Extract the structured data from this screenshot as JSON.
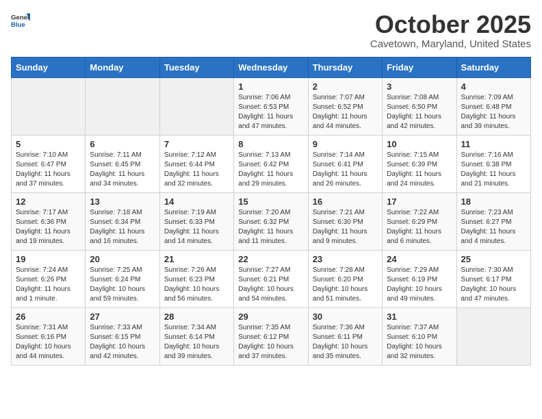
{
  "header": {
    "logo_general": "General",
    "logo_blue": "Blue",
    "month": "October 2025",
    "location": "Cavetown, Maryland, United States"
  },
  "weekdays": [
    "Sunday",
    "Monday",
    "Tuesday",
    "Wednesday",
    "Thursday",
    "Friday",
    "Saturday"
  ],
  "weeks": [
    [
      {
        "day": "",
        "info": ""
      },
      {
        "day": "",
        "info": ""
      },
      {
        "day": "",
        "info": ""
      },
      {
        "day": "1",
        "info": "Sunrise: 7:06 AM\nSunset: 6:53 PM\nDaylight: 11 hours and 47 minutes."
      },
      {
        "day": "2",
        "info": "Sunrise: 7:07 AM\nSunset: 6:52 PM\nDaylight: 11 hours and 44 minutes."
      },
      {
        "day": "3",
        "info": "Sunrise: 7:08 AM\nSunset: 6:50 PM\nDaylight: 11 hours and 42 minutes."
      },
      {
        "day": "4",
        "info": "Sunrise: 7:09 AM\nSunset: 6:48 PM\nDaylight: 11 hours and 39 minutes."
      }
    ],
    [
      {
        "day": "5",
        "info": "Sunrise: 7:10 AM\nSunset: 6:47 PM\nDaylight: 11 hours and 37 minutes."
      },
      {
        "day": "6",
        "info": "Sunrise: 7:11 AM\nSunset: 6:45 PM\nDaylight: 11 hours and 34 minutes."
      },
      {
        "day": "7",
        "info": "Sunrise: 7:12 AM\nSunset: 6:44 PM\nDaylight: 11 hours and 32 minutes."
      },
      {
        "day": "8",
        "info": "Sunrise: 7:13 AM\nSunset: 6:42 PM\nDaylight: 11 hours and 29 minutes."
      },
      {
        "day": "9",
        "info": "Sunrise: 7:14 AM\nSunset: 6:41 PM\nDaylight: 11 hours and 26 minutes."
      },
      {
        "day": "10",
        "info": "Sunrise: 7:15 AM\nSunset: 6:39 PM\nDaylight: 11 hours and 24 minutes."
      },
      {
        "day": "11",
        "info": "Sunrise: 7:16 AM\nSunset: 6:38 PM\nDaylight: 11 hours and 21 minutes."
      }
    ],
    [
      {
        "day": "12",
        "info": "Sunrise: 7:17 AM\nSunset: 6:36 PM\nDaylight: 11 hours and 19 minutes."
      },
      {
        "day": "13",
        "info": "Sunrise: 7:18 AM\nSunset: 6:34 PM\nDaylight: 11 hours and 16 minutes."
      },
      {
        "day": "14",
        "info": "Sunrise: 7:19 AM\nSunset: 6:33 PM\nDaylight: 11 hours and 14 minutes."
      },
      {
        "day": "15",
        "info": "Sunrise: 7:20 AM\nSunset: 6:32 PM\nDaylight: 11 hours and 11 minutes."
      },
      {
        "day": "16",
        "info": "Sunrise: 7:21 AM\nSunset: 6:30 PM\nDaylight: 11 hours and 9 minutes."
      },
      {
        "day": "17",
        "info": "Sunrise: 7:22 AM\nSunset: 6:29 PM\nDaylight: 11 hours and 6 minutes."
      },
      {
        "day": "18",
        "info": "Sunrise: 7:23 AM\nSunset: 6:27 PM\nDaylight: 11 hours and 4 minutes."
      }
    ],
    [
      {
        "day": "19",
        "info": "Sunrise: 7:24 AM\nSunset: 6:26 PM\nDaylight: 11 hours and 1 minute."
      },
      {
        "day": "20",
        "info": "Sunrise: 7:25 AM\nSunset: 6:24 PM\nDaylight: 10 hours and 59 minutes."
      },
      {
        "day": "21",
        "info": "Sunrise: 7:26 AM\nSunset: 6:23 PM\nDaylight: 10 hours and 56 minutes."
      },
      {
        "day": "22",
        "info": "Sunrise: 7:27 AM\nSunset: 6:21 PM\nDaylight: 10 hours and 54 minutes."
      },
      {
        "day": "23",
        "info": "Sunrise: 7:28 AM\nSunset: 6:20 PM\nDaylight: 10 hours and 51 minutes."
      },
      {
        "day": "24",
        "info": "Sunrise: 7:29 AM\nSunset: 6:19 PM\nDaylight: 10 hours and 49 minutes."
      },
      {
        "day": "25",
        "info": "Sunrise: 7:30 AM\nSunset: 6:17 PM\nDaylight: 10 hours and 47 minutes."
      }
    ],
    [
      {
        "day": "26",
        "info": "Sunrise: 7:31 AM\nSunset: 6:16 PM\nDaylight: 10 hours and 44 minutes."
      },
      {
        "day": "27",
        "info": "Sunrise: 7:33 AM\nSunset: 6:15 PM\nDaylight: 10 hours and 42 minutes."
      },
      {
        "day": "28",
        "info": "Sunrise: 7:34 AM\nSunset: 6:14 PM\nDaylight: 10 hours and 39 minutes."
      },
      {
        "day": "29",
        "info": "Sunrise: 7:35 AM\nSunset: 6:12 PM\nDaylight: 10 hours and 37 minutes."
      },
      {
        "day": "30",
        "info": "Sunrise: 7:36 AM\nSunset: 6:11 PM\nDaylight: 10 hours and 35 minutes."
      },
      {
        "day": "31",
        "info": "Sunrise: 7:37 AM\nSunset: 6:10 PM\nDaylight: 10 hours and 32 minutes."
      },
      {
        "day": "",
        "info": ""
      }
    ]
  ]
}
